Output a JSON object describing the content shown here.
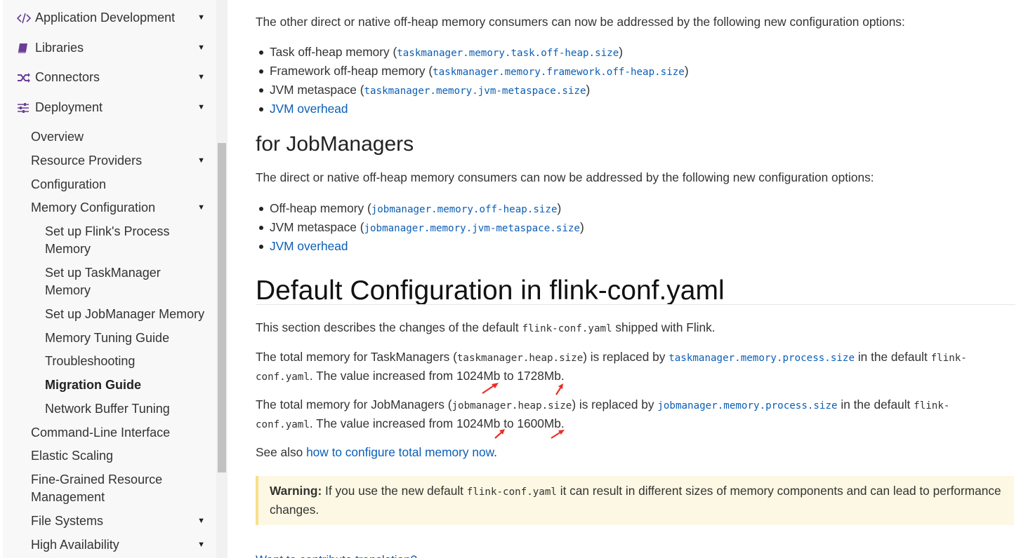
{
  "sidebar": {
    "top_items": [
      {
        "label": "Application Development",
        "icon": "code-icon"
      },
      {
        "label": "Libraries",
        "icon": "book-icon"
      },
      {
        "label": "Connectors",
        "icon": "shuffle-icon"
      },
      {
        "label": "Deployment",
        "icon": "sliders-icon"
      }
    ],
    "deployment_items": [
      "Overview",
      "Resource Providers",
      "Configuration",
      "Memory Configuration"
    ],
    "memory_items": [
      "Set up Flink's Process Memory",
      "Set up TaskManager Memory",
      "Set up JobManager Memory",
      "Memory Tuning Guide",
      "Troubleshooting",
      "Migration Guide",
      "Network Buffer Tuning"
    ],
    "more_items": [
      "Command-Line Interface",
      "Elastic Scaling",
      "Fine-Grained Resource Management",
      "File Systems",
      "High Availability"
    ],
    "active_item": "Migration Guide"
  },
  "content": {
    "tm_intro": "The other direct or native off-heap memory consumers can now be addressed by the following new configuration options:",
    "tm_options": [
      {
        "label": "Task off-heap memory",
        "code": "taskmanager.memory.task.off-heap.size"
      },
      {
        "label": "Framework off-heap memory",
        "code": "taskmanager.memory.framework.off-heap.size"
      },
      {
        "label": "JVM metaspace",
        "code": "taskmanager.memory.jvm-metaspace.size"
      }
    ],
    "tm_overhead_link": "JVM overhead",
    "jm_heading": "for JobManagers",
    "jm_intro": "The direct or native off-heap memory consumers can now be addressed by the following new configuration options:",
    "jm_options": [
      {
        "label": "Off-heap memory",
        "code": "jobmanager.memory.off-heap.size"
      },
      {
        "label": "JVM metaspace",
        "code": "jobmanager.memory.jvm-metaspace.size"
      }
    ],
    "jm_overhead_link": "JVM overhead",
    "default_heading": "Default Configuration in flink-conf.yaml",
    "default_desc": {
      "before": "This section describes the changes of the default ",
      "code": "flink-conf.yaml",
      "after": " shipped with Flink."
    },
    "tm_total": {
      "t1": "The total memory for TaskManagers (",
      "old_key": "taskmanager.heap.size",
      "t2": ") is replaced by ",
      "new_key": "taskmanager.memory.process.size",
      "t3": " in the default ",
      "code_a": "flink-",
      "code_b": "conf.yaml",
      "t4": ". The value increased from 1024Mb to 1728Mb."
    },
    "jm_total": {
      "t1": "The total memory for JobManagers (",
      "old_key": "jobmanager.heap.size",
      "t2": ") is replaced by ",
      "new_key": "jobmanager.memory.process.size",
      "t3": " in the default ",
      "code_a": "flink-",
      "code_b": "conf.yaml",
      "t4": ". The value increased from 1024Mb to 1600Mb."
    },
    "see_also": {
      "before": "See also ",
      "link": "how to configure total memory now",
      "after": "."
    },
    "warning": {
      "label": "Warning:",
      "before": " If you use the new default ",
      "code": "flink-conf.yaml",
      "after": " it can result in different sizes of memory components and can lead to performance changes."
    },
    "cut_link": "Want to contribute translation?"
  },
  "colors": {
    "link": "#0b5eb6",
    "icon": "#6a3e96",
    "warning_bg": "#fcf8e3",
    "warning_border": "#f7e08a",
    "annotation_arrow": "#e8302a"
  }
}
